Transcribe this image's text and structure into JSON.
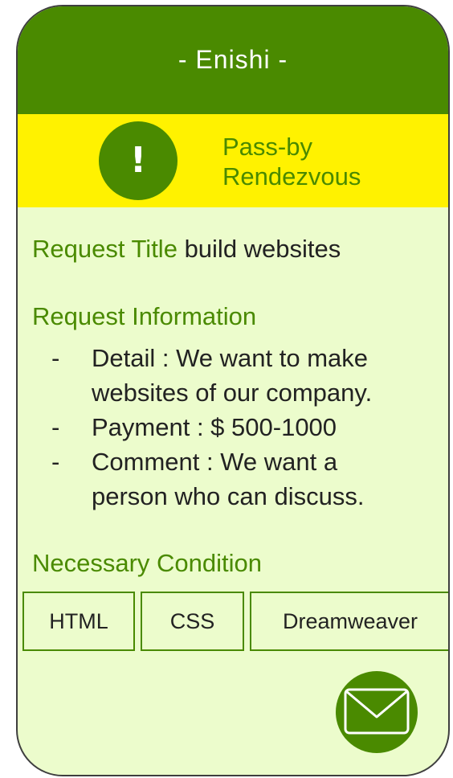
{
  "header": {
    "title": "- Enishi -"
  },
  "alert": {
    "icon": "!",
    "line1": "Pass-by",
    "line2": "Rendezvous"
  },
  "request": {
    "title_label": "Request Title",
    "title_value": "build websites",
    "info_heading": "Request Information",
    "info_items": [
      {
        "dash": "-",
        "line1": "Detail : We want to make",
        "line2": "websites of our company."
      },
      {
        "dash": "-",
        "line1": "Payment : $ 500-1000",
        "line2": ""
      },
      {
        "dash": "-",
        "line1": "Comment : We want a",
        "line2": "person who can discuss."
      }
    ]
  },
  "conditions": {
    "heading": "Necessary Condition",
    "tags": [
      "HTML",
      "CSS",
      "Dreamweaver"
    ]
  },
  "actions": {
    "mail_icon": "envelope-icon"
  },
  "colors": {
    "header_green": "#4a8a00",
    "alert_yellow": "#fff200",
    "card_background": "#ecfccc",
    "frame_border": "#3f3f3f"
  }
}
